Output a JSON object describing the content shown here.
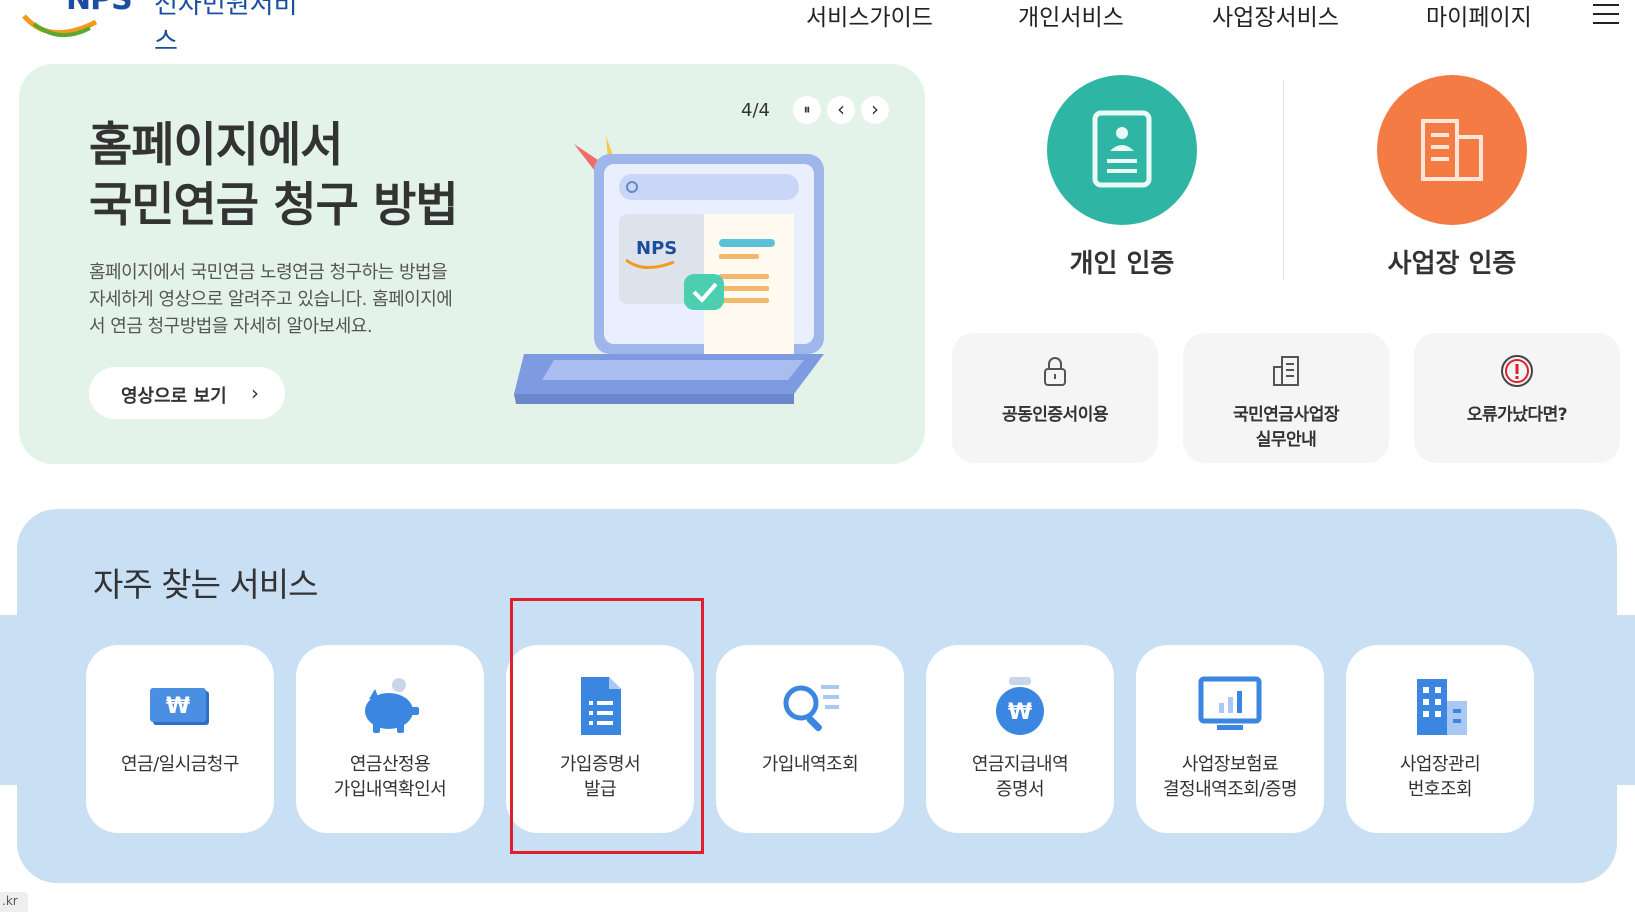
{
  "header": {
    "logo_mark": "NPS",
    "logo_text": "전자민원서비스",
    "nav": [
      "서비스가이드",
      "개인서비스",
      "사업장서비스",
      "마이페이지"
    ]
  },
  "banner": {
    "title_line1": "홈페이지에서",
    "title_line2": "국민연금 청구 방법",
    "desc_line1": "홈페이지에서 국민연금 노령연금 청구하는 방법을",
    "desc_line2": "자세하게 영상으로 알려주고 있습니다. 홈페이지에",
    "desc_line3": "서 연금 청구방법을 자세히 알아보세요.",
    "button_label": "영상으로 보기",
    "button_chevron": "›",
    "pager": "4/4",
    "pause_symbol": "⏸",
    "prev_symbol": "‹",
    "next_symbol": "›",
    "illus_logo": "NPS"
  },
  "auth": {
    "personal": "개인 인증",
    "business": "사업장 인증",
    "personal_color": "#2fb5a3",
    "business_color": "#f47b43"
  },
  "quick": [
    {
      "line1": "공동인증서이용",
      "line2": ""
    },
    {
      "line1": "국민연금사업장",
      "line2": "실무안내"
    },
    {
      "line1": "오류가났다면?",
      "line2": ""
    }
  ],
  "freq": {
    "title": "자주 찾는 서비스",
    "items": [
      {
        "line1": "연금/일시금청구",
        "line2": ""
      },
      {
        "line1": "연금산정용",
        "line2": "가입내역확인서"
      },
      {
        "line1": "가입증명서",
        "line2": "발급"
      },
      {
        "line1": "가입내역조회",
        "line2": ""
      },
      {
        "line1": "연금지급내역",
        "line2": "증명서"
      },
      {
        "line1": "사업장보험료",
        "line2": "결정내역조회/증명"
      },
      {
        "line1": "사업장관리",
        "line2": "번호조회"
      }
    ],
    "won_symbol": "₩"
  },
  "status_url": ".kr",
  "colors": {
    "accent": "#3a7bd5",
    "highlight": "#e0202a",
    "panel": "#c8dff4",
    "banner": "#e4f3ea"
  }
}
